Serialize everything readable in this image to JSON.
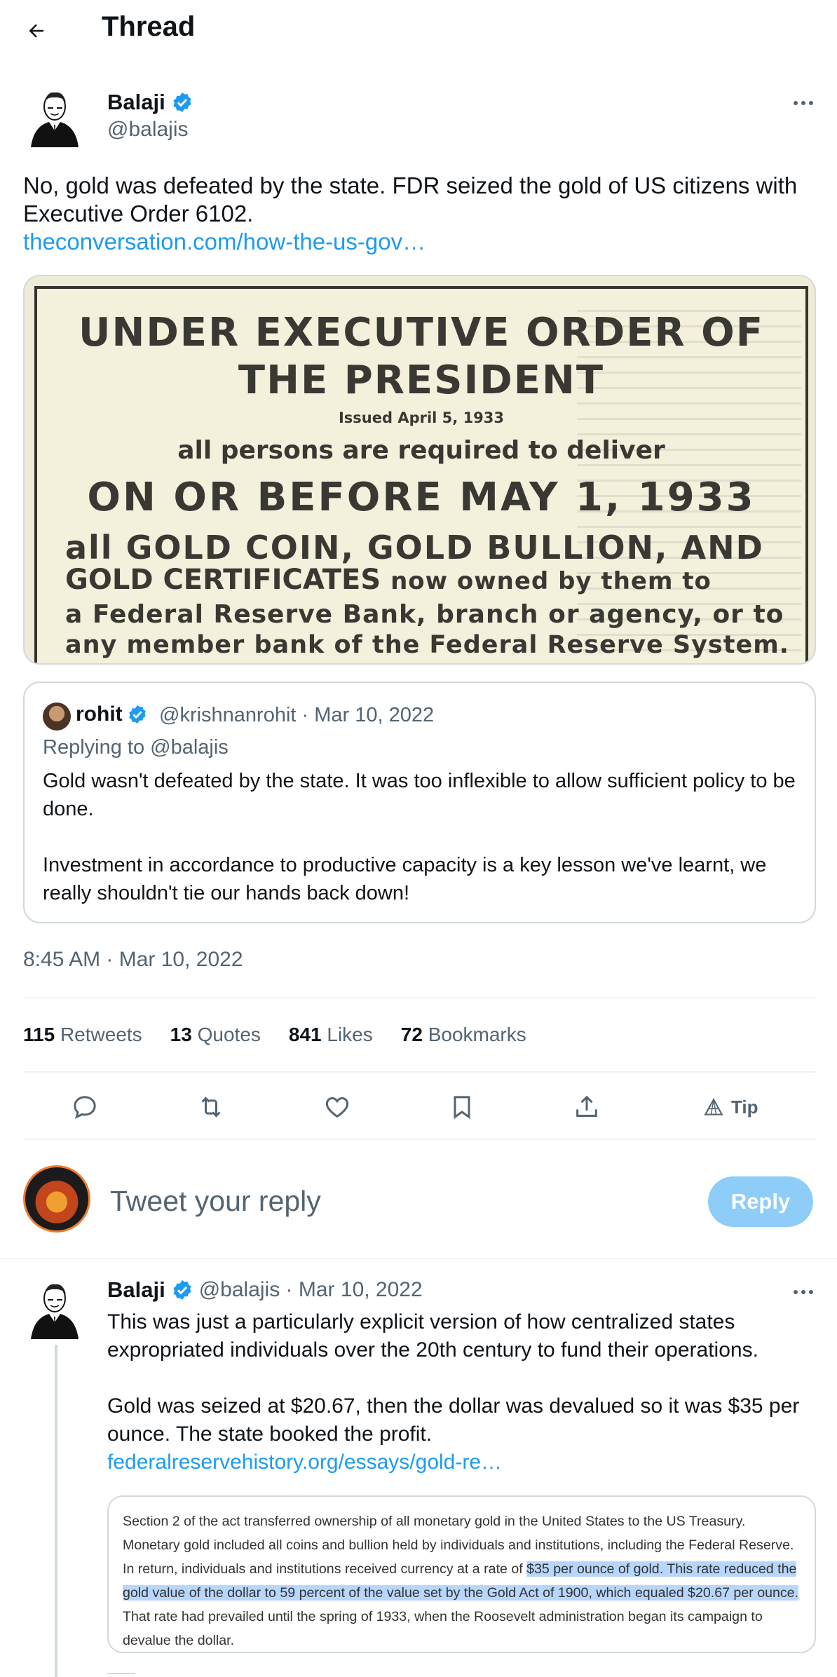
{
  "header": {
    "title": "Thread"
  },
  "main_tweet": {
    "author_name": "Balaji",
    "author_handle": "@balajis",
    "text": "No, gold was defeated by the state. FDR seized the gold of US citizens with Executive Order 6102.",
    "link": "theconversation.com/how-the-us-gov…",
    "image_text": {
      "line1": "UNDER EXECUTIVE ORDER OF",
      "line2": "THE PRESIDENT",
      "line3": "Issued April 5, 1933",
      "line4": "all persons are required to deliver",
      "line5": "ON OR BEFORE MAY 1, 1933",
      "line6": "all GOLD COIN, GOLD BULLION, AND",
      "line7a": "GOLD CERTIFICATES",
      "line7b": "now owned by them to",
      "line8": "a Federal Reserve Bank, branch or agency, or to",
      "line9": "any member bank of the Federal Reserve System."
    },
    "timestamp": "8:45 AM · Mar 10, 2022"
  },
  "quote": {
    "name": "rohit",
    "meta": "@krishnanrohit · Mar 10, 2022",
    "replying": "Replying to @balajis",
    "para1": "Gold wasn't defeated by the state. It was too inflexible to allow sufficient policy to be done.",
    "para2": "Investment in accordance to productive capacity is a key lesson we've learnt, we really shouldn't tie our hands back down!"
  },
  "stats": {
    "retweets_count": "115",
    "retweets_label": "Retweets",
    "quotes_count": "13",
    "quotes_label": "Quotes",
    "likes_count": "841",
    "likes_label": "Likes",
    "bookmarks_count": "72",
    "bookmarks_label": "Bookmarks"
  },
  "actions": {
    "tip_label": "Tip"
  },
  "composer": {
    "placeholder": "Tweet your reply",
    "reply_label": "Reply"
  },
  "reply_tweet": {
    "author_name": "Balaji",
    "meta": "@balajis · Mar 10, 2022",
    "para1": "This was just a particularly explicit version of how centralized states expropriated individuals over the 20th century to fund their operations.",
    "para2": "Gold was seized at $20.67, then the dollar was devalued so it was $35 per ounce. The state booked the profit.",
    "link": "federalreservehistory.org/essays/gold-re…",
    "excerpt_before": "Section 2 of the act transferred ownership of all monetary gold in the United States to the US Treasury. Monetary gold included all coins and bullion held by individuals and institutions, including the Federal Reserve. In return, individuals and institutions received currency at a rate of ",
    "excerpt_highlight": "$35 per ounce of gold. This rate reduced the gold value of the dollar to 59 percent of the value set by the Gold Act of 1900, which equaled $20.67 per ounce.",
    "excerpt_after": " That rate had prevailed until the spring of 1933, when the Roosevelt administration began its campaign to devalue the dollar."
  },
  "colors": {
    "accent": "#1d9bf0",
    "reply_button": "#8ecdf8",
    "muted": "#536471"
  }
}
